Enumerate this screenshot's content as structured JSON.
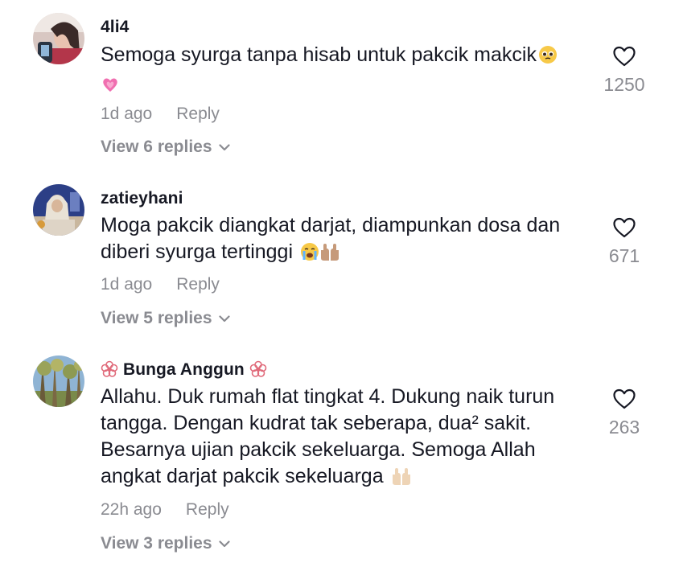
{
  "comments": [
    {
      "username": "4li4",
      "text": "Semoga syurga tanpa hisab untuk pakcik makcik",
      "time": "1d ago",
      "reply_label": "Reply",
      "view_replies": "View 6 replies",
      "like_count": "1250"
    },
    {
      "username": "zatieyhani",
      "text": "Moga pakcik diangkat darjat, diampunkan dosa dan diberi syurga tertinggi",
      "time": "1d ago",
      "reply_label": "Reply",
      "view_replies": "View 5 replies",
      "like_count": "671"
    },
    {
      "username": "Bunga Anggun",
      "text": "Allahu. Duk rumah flat tingkat 4. Dukung naik turun tangga. Dengan kudrat tak seberapa, dua² sakit. Besarnya ujian pakcik sekeluarga. Semoga Allah angkat darjat pakcik sekeluarga",
      "time": "22h ago",
      "reply_label": "Reply",
      "view_replies": "View 3 replies",
      "like_count": "263"
    }
  ],
  "colors": {
    "text_primary": "#161823",
    "text_secondary": "#8a8b91",
    "background": "#ffffff"
  },
  "icons": {
    "like": "heart-outline-icon",
    "expand": "chevron-down-icon",
    "username_decoration": "flower-icon"
  }
}
